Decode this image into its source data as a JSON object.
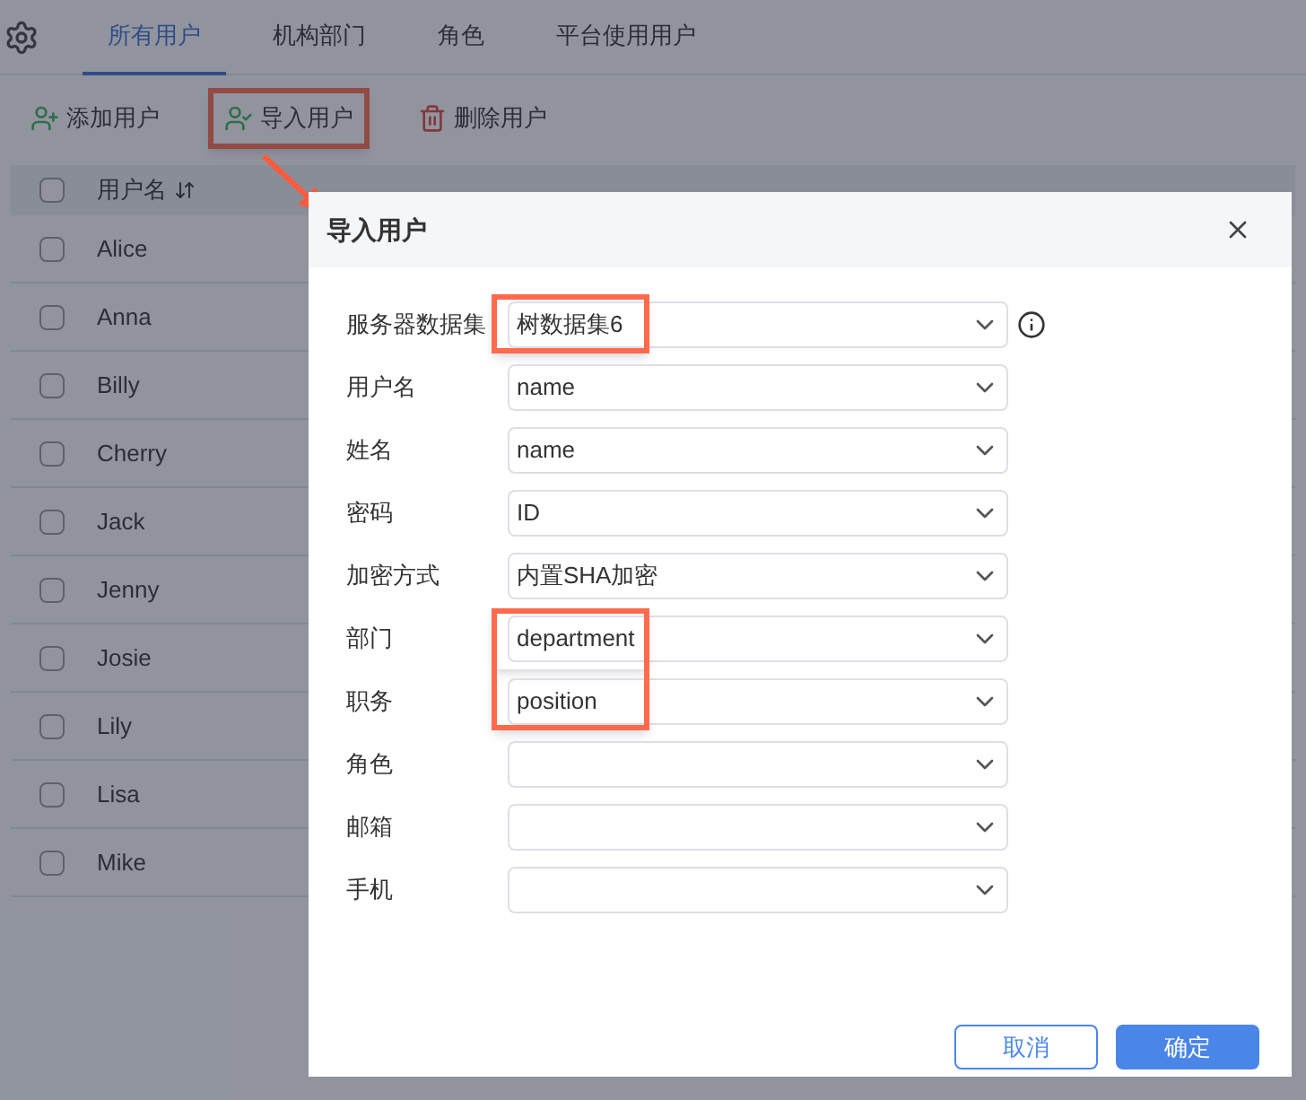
{
  "tabs": [
    {
      "label": "所有用户",
      "selected": true
    },
    {
      "label": "机构部门",
      "selected": false
    },
    {
      "label": "角色",
      "selected": false
    },
    {
      "label": "平台使用用户",
      "selected": false
    }
  ],
  "toolbar": [
    {
      "kind": "add",
      "label": "添加用户",
      "highlighted": false
    },
    {
      "kind": "import",
      "label": "导入用户",
      "highlighted": true
    },
    {
      "kind": "delete",
      "label": "删除用户",
      "highlighted": false
    }
  ],
  "table": {
    "select_all_checked": false,
    "columns": [
      "用户名"
    ],
    "rows": [
      {
        "username": "Alice",
        "checked": false
      },
      {
        "username": "Anna",
        "checked": false
      },
      {
        "username": "Billy",
        "checked": false
      },
      {
        "username": "Cherry",
        "checked": false
      },
      {
        "username": "Jack",
        "checked": false
      },
      {
        "username": "Jenny",
        "checked": false
      },
      {
        "username": "Josie",
        "checked": false
      },
      {
        "username": "Lily",
        "checked": false
      },
      {
        "username": "Lisa",
        "checked": false
      },
      {
        "username": "Mike",
        "checked": false
      }
    ]
  },
  "dialog": {
    "title": "导入用户",
    "fields": [
      {
        "label": "服务器数据集",
        "value": "树数据集6",
        "highlighted": true,
        "info": true
      },
      {
        "label": "用户名",
        "value": "name",
        "highlighted": false,
        "info": false
      },
      {
        "label": "姓名",
        "value": "name",
        "highlighted": false,
        "info": false
      },
      {
        "label": "密码",
        "value": "ID",
        "highlighted": false,
        "info": false
      },
      {
        "label": "加密方式",
        "value": "内置SHA加密",
        "highlighted": false,
        "info": false
      },
      {
        "label": "部门",
        "value": "department",
        "highlighted": true,
        "info": false
      },
      {
        "label": "职务",
        "value": "position",
        "highlighted": true,
        "info": false
      },
      {
        "label": "角色",
        "highlighted": false,
        "info": false
      },
      {
        "label": "邮箱",
        "highlighted": false,
        "info": false
      },
      {
        "label": "手机",
        "highlighted": false,
        "info": false
      }
    ],
    "buttons": [
      {
        "kind": "secondary",
        "label": "取消"
      },
      {
        "kind": "primary",
        "label": "确定"
      }
    ]
  }
}
